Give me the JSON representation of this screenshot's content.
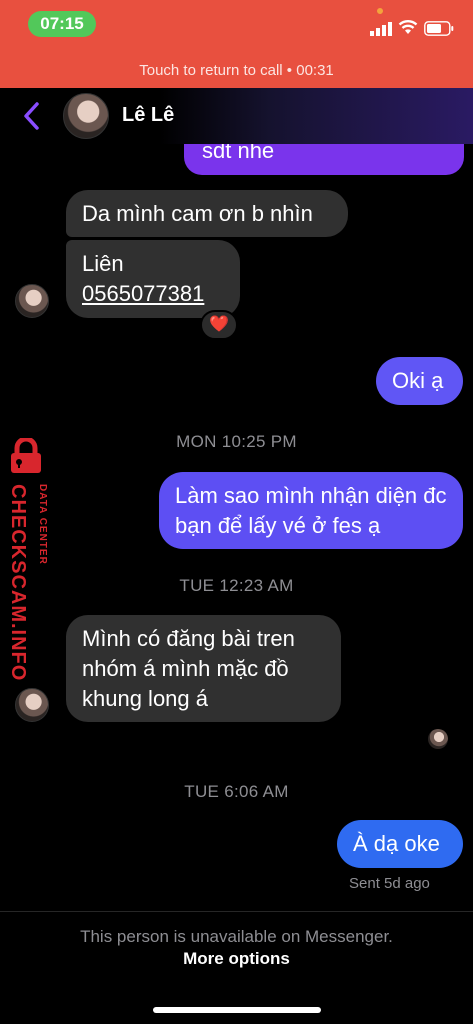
{
  "status_bar": {
    "time": "07:15",
    "icons": [
      "signal-icon",
      "wifi-icon",
      "battery-icon"
    ]
  },
  "call_banner": {
    "text": "Touch to return to call • 00:31",
    "color": "#e8503f"
  },
  "header": {
    "contact_name": "Lê Lê",
    "back_icon": "chevron-left-icon"
  },
  "messages": {
    "partial_top": "sdt nhe",
    "m1": "Da mình cam ơn b nhìn",
    "m2_line1": "Liên",
    "m2_phone": "0565077381",
    "m2_reaction": "❤️",
    "m3": "Oki ạ",
    "ts1": "MON 10:25 PM",
    "m4": "Làm sao mình nhận diện đc bạn để lấy vé ở fes ạ",
    "ts2": "TUE 12:23 AM",
    "m5": "Mình có đăng bài tren nhóm á mình mặc đồ khung long á",
    "ts3": "TUE 6:06 AM",
    "m6": "À dạ oke",
    "sent_status": "Sent 5d ago"
  },
  "watermark": {
    "main": "CHECKSCAM.INFO",
    "sub": "DATA CENTER",
    "icon": "lock-icon"
  },
  "footer": {
    "notice": "This person is unavailable on Messenger.",
    "more_options": "More options"
  },
  "colors": {
    "outgoing_bubble": "#6056f5",
    "outgoing_bubble_last": "#2f6bf1",
    "incoming_bubble": "#303030",
    "accent": "#7a34ec"
  }
}
